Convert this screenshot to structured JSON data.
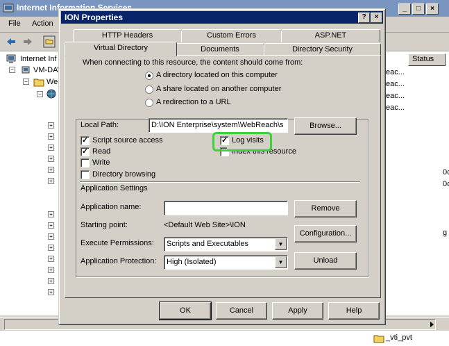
{
  "background_window": {
    "title": "Internet Information Services",
    "menu": [
      "File",
      "Action"
    ],
    "tree": {
      "root": "Internet Inf",
      "server": "VM-DAV",
      "websites": "We"
    },
    "list_header": "Status",
    "list_rows": [
      "eac...",
      "eac...",
      "eac...",
      "eac..."
    ],
    "right_edge_fragments": [
      "0c",
      "0c",
      "g"
    ],
    "bottom_item": "_vti_pvt"
  },
  "dialog": {
    "title": "ION Properties",
    "help_btn": "?",
    "close_btn": "×",
    "tabs_back": [
      "HTTP Headers",
      "Custom Errors",
      "ASP.NET"
    ],
    "tabs_front": [
      "Virtual Directory",
      "Documents",
      "Directory Security"
    ],
    "content_source_prompt": "When connecting to this resource, the content should come from:",
    "radio_options": [
      {
        "label": "A directory located on this computer",
        "checked": true
      },
      {
        "label": "A share located on another computer",
        "checked": false
      },
      {
        "label": "A redirection to a URL",
        "checked": false
      }
    ],
    "local_path_label": "Local Path:",
    "local_path_value": "D:\\ION Enterprise\\system\\WebReach\\s",
    "browse_button": "Browse...",
    "checkboxes_left": [
      {
        "label": "Script source access",
        "checked": true
      },
      {
        "label": "Read",
        "checked": true
      },
      {
        "label": "Write",
        "checked": false
      },
      {
        "label": "Directory browsing",
        "checked": false
      }
    ],
    "checkboxes_right": [
      {
        "label": "Log visits",
        "checked": true
      },
      {
        "label": "Index this resource",
        "checked": false
      }
    ],
    "app_settings_title": "Application Settings",
    "app_name_label": "Application name:",
    "app_name_value": "",
    "remove_button": "Remove",
    "starting_point_label": "Starting point:",
    "starting_point_value": "<Default Web Site>\\ION",
    "configuration_button": "Configuration...",
    "exec_perm_label": "Execute Permissions:",
    "exec_perm_value": "Scripts and Executables",
    "app_protection_label": "Application Protection:",
    "app_protection_value": "High (Isolated)",
    "unload_button": "Unload",
    "ok_button": "OK",
    "cancel_button": "Cancel",
    "apply_button": "Apply",
    "help_button": "Help"
  },
  "colors": {
    "dialog_title_bg": "#0a246a",
    "highlight": "#3cd23c",
    "face": "#d4d0c8"
  }
}
